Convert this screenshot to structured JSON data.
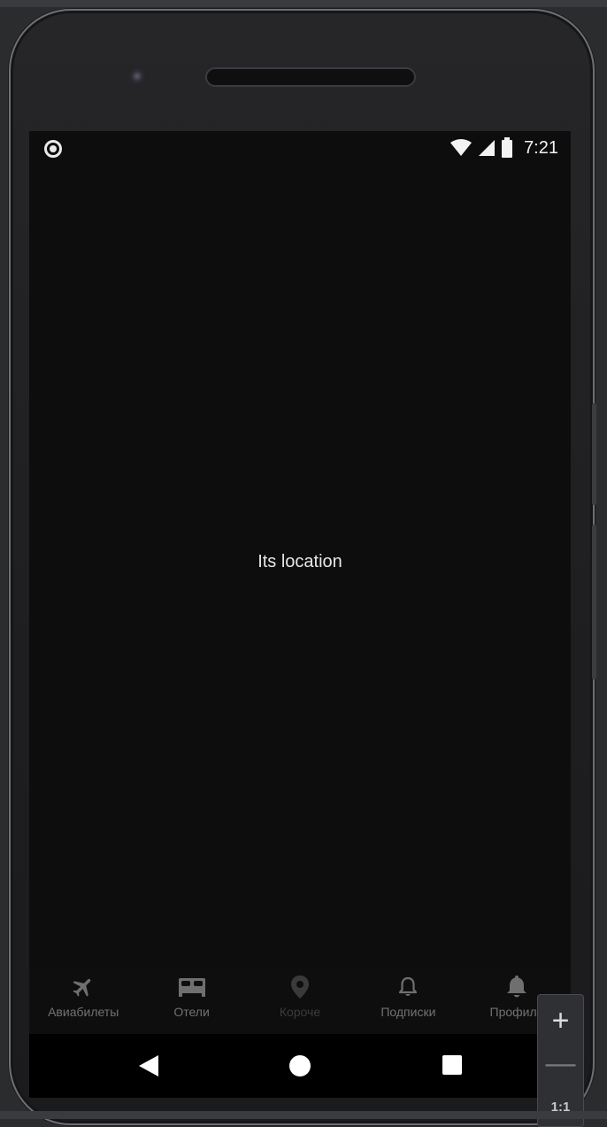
{
  "status_bar": {
    "time": "7:21"
  },
  "main": {
    "center_text": "Its location"
  },
  "bottom_nav": {
    "items": [
      {
        "label": "Авиабилеты",
        "icon": "airplane-icon"
      },
      {
        "label": "Отели",
        "icon": "bed-icon"
      },
      {
        "label": "Короче",
        "icon": "location-pin-icon"
      },
      {
        "label": "Подписки",
        "icon": "bell-outline-icon"
      },
      {
        "label": "Профиль",
        "icon": "bell-filled-icon"
      }
    ]
  },
  "emulator_zoom": {
    "plus": "+",
    "minus": "—",
    "ratio": "1:1"
  },
  "colors": {
    "screen_bg": "#0d0d0e",
    "nav_label": "#727272",
    "text": "#e6e6e6"
  }
}
